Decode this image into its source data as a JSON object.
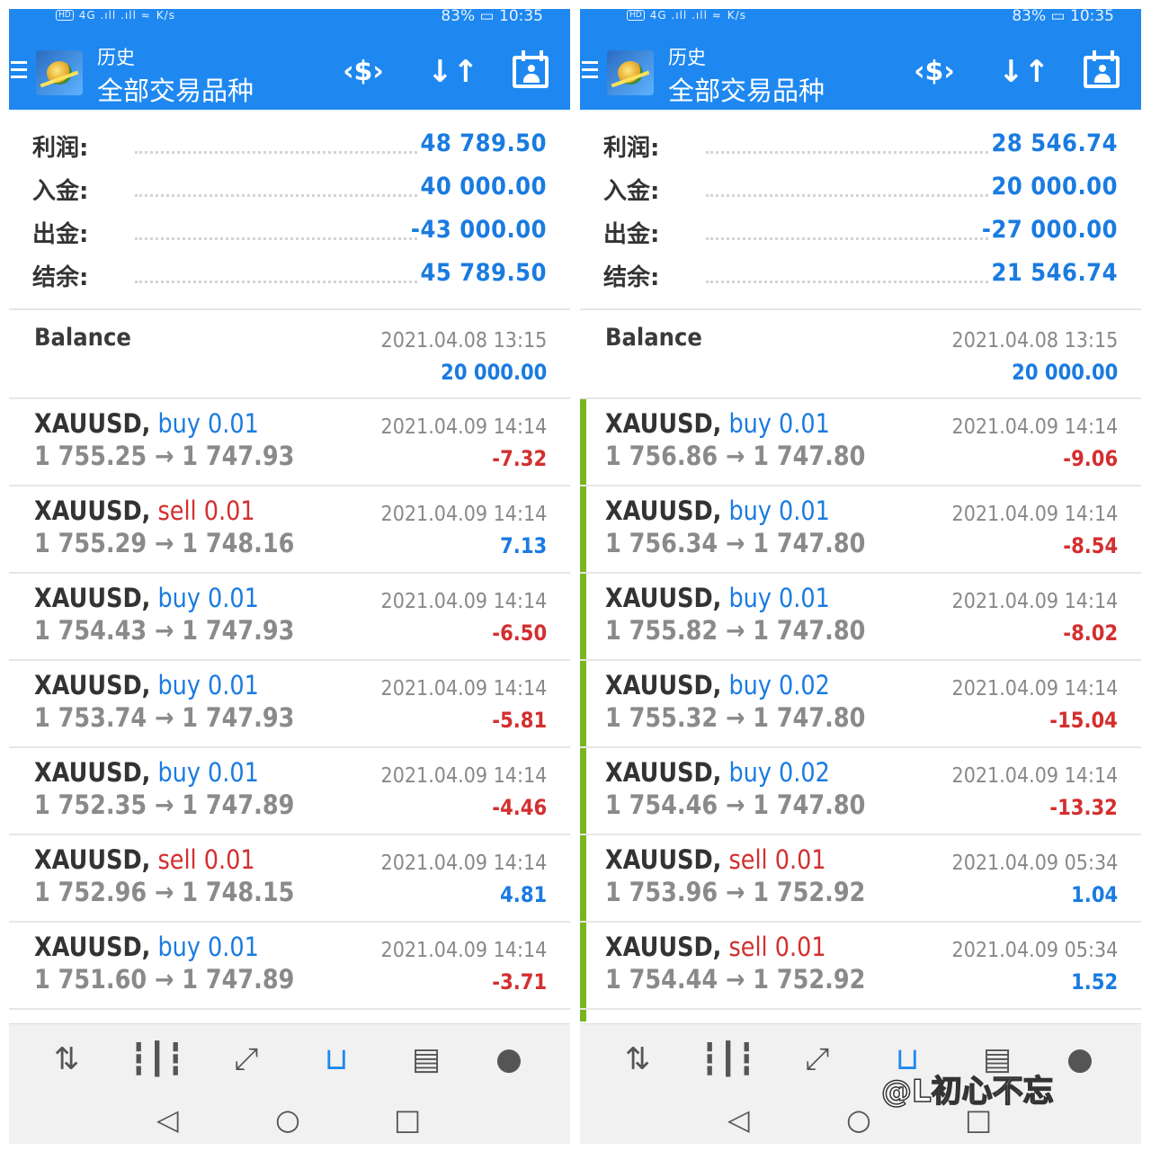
{
  "left": {
    "status": {
      "net": "HD",
      "speed": "K/s",
      "battery": "83%",
      "time": "10:35",
      "signal": "4G .ıll .ıll ≈"
    },
    "header": {
      "subtitle": "历史",
      "title": "全部交易品种"
    },
    "summary": [
      {
        "label": "利润:",
        "value": "48 789.50"
      },
      {
        "label": "入金:",
        "value": "40 000.00"
      },
      {
        "label": "出金:",
        "value": "-43 000.00"
      },
      {
        "label": "结余:",
        "value": "45 789.50"
      }
    ],
    "balance": {
      "label": "Balance",
      "date": "2021.04.08 13:15",
      "value": "20 000.00"
    },
    "trades": [
      {
        "symbol": "XAUUSD,",
        "side": "buy 0.01",
        "prices": "1 755.25 → 1 747.93",
        "date": "2021.04.09 14:14",
        "profit": "-7.32"
      },
      {
        "symbol": "XAUUSD,",
        "side": "sell 0.01",
        "prices": "1 755.29 → 1 748.16",
        "date": "2021.04.09 14:14",
        "profit": "7.13"
      },
      {
        "symbol": "XAUUSD,",
        "side": "buy 0.01",
        "prices": "1 754.43 → 1 747.93",
        "date": "2021.04.09 14:14",
        "profit": "-6.50"
      },
      {
        "symbol": "XAUUSD,",
        "side": "buy 0.01",
        "prices": "1 753.74 → 1 747.93",
        "date": "2021.04.09 14:14",
        "profit": "-5.81"
      },
      {
        "symbol": "XAUUSD,",
        "side": "buy 0.01",
        "prices": "1 752.35 → 1 747.89",
        "date": "2021.04.09 14:14",
        "profit": "-4.46"
      },
      {
        "symbol": "XAUUSD,",
        "side": "sell 0.01",
        "prices": "1 752.96 → 1 748.15",
        "date": "2021.04.09 14:14",
        "profit": "4.81"
      },
      {
        "symbol": "XAUUSD,",
        "side": "buy 0.01",
        "prices": "1 751.60 → 1 747.89",
        "date": "2021.04.09 14:14",
        "profit": "-3.71"
      }
    ]
  },
  "right": {
    "status": {
      "net": "HD",
      "speed": "K/s",
      "battery": "83%",
      "time": "10:35",
      "signal": "4G .ıll .ıll ≈"
    },
    "header": {
      "subtitle": "历史",
      "title": "全部交易品种"
    },
    "summary": [
      {
        "label": "利润:",
        "value": "28 546.74"
      },
      {
        "label": "入金:",
        "value": "20 000.00"
      },
      {
        "label": "出金:",
        "value": "-27 000.00"
      },
      {
        "label": "结余:",
        "value": "21 546.74"
      }
    ],
    "balance": {
      "label": "Balance",
      "date": "2021.04.08 13:15",
      "value": "20 000.00"
    },
    "trades": [
      {
        "symbol": "XAUUSD,",
        "side": "buy 0.01",
        "prices": "1 756.86 → 1 747.80",
        "date": "2021.04.09 14:14",
        "profit": "-9.06"
      },
      {
        "symbol": "XAUUSD,",
        "side": "buy 0.01",
        "prices": "1 756.34 → 1 747.80",
        "date": "2021.04.09 14:14",
        "profit": "-8.54"
      },
      {
        "symbol": "XAUUSD,",
        "side": "buy 0.01",
        "prices": "1 755.82 → 1 747.80",
        "date": "2021.04.09 14:14",
        "profit": "-8.02"
      },
      {
        "symbol": "XAUUSD,",
        "side": "buy 0.02",
        "prices": "1 755.32 → 1 747.80",
        "date": "2021.04.09 14:14",
        "profit": "-15.04"
      },
      {
        "symbol": "XAUUSD,",
        "side": "buy 0.02",
        "prices": "1 754.46 → 1 747.80",
        "date": "2021.04.09 14:14",
        "profit": "-13.32"
      },
      {
        "symbol": "XAUUSD,",
        "side": "sell 0.01",
        "prices": "1 753.96 → 1 752.92",
        "date": "2021.04.09 05:34",
        "profit": "1.04"
      },
      {
        "symbol": "XAUUSD,",
        "side": "sell 0.01",
        "prices": "1 754.44 → 1 752.92",
        "date": "2021.04.09 05:34",
        "profit": "1.52"
      }
    ]
  },
  "icons": {
    "toolbar": [
      "money-exchange-icon",
      "sort-icon",
      "calendar-icon"
    ],
    "nav": [
      "quotes-icon",
      "chart-icon",
      "trade-icon",
      "history-icon",
      "news-icon",
      "chat-icon"
    ],
    "system": [
      "back-icon",
      "home-icon",
      "recents-icon"
    ]
  },
  "watermark": "@L初心不忘",
  "colors": {
    "header": "#1e88f0",
    "positive": "#1a7be0",
    "negative": "#d32f2f",
    "marker": "#7ab520"
  }
}
